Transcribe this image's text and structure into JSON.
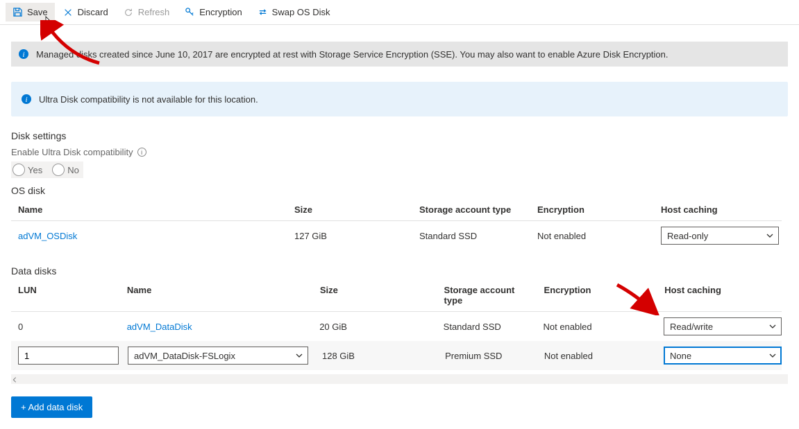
{
  "toolbar": {
    "save": "Save",
    "discard": "Discard",
    "refresh": "Refresh",
    "encryption": "Encryption",
    "swap": "Swap OS Disk"
  },
  "banners": {
    "sse": "Managed disks created since June 10, 2017 are encrypted at rest with Storage Service Encryption (SSE). You may also want to enable Azure Disk Encryption.",
    "ultra": "Ultra Disk compatibility is not available for this location."
  },
  "sections": {
    "diskSettings": "Disk settings",
    "ultraLabel": "Enable Ultra Disk compatibility",
    "yes": "Yes",
    "no": "No",
    "osDisk": "OS disk",
    "dataDisks": "Data disks"
  },
  "osTable": {
    "headers": {
      "name": "Name",
      "size": "Size",
      "storage": "Storage account type",
      "encryption": "Encryption",
      "caching": "Host caching"
    },
    "row": {
      "name": "adVM_OSDisk",
      "size": "127 GiB",
      "storage": "Standard SSD",
      "encryption": "Not enabled",
      "caching": "Read-only"
    }
  },
  "dataTable": {
    "headers": {
      "lun": "LUN",
      "name": "Name",
      "size": "Size",
      "storage": "Storage account type",
      "encryption": "Encryption",
      "caching": "Host caching"
    },
    "rows": [
      {
        "lun": "0",
        "name": "adVM_DataDisk",
        "size": "20 GiB",
        "storage": "Standard SSD",
        "encryption": "Not enabled",
        "caching": "Read/write"
      },
      {
        "lun": "1",
        "name": "adVM_DataDisk-FSLogix",
        "size": "128 GiB",
        "storage": "Premium SSD",
        "encryption": "Not enabled",
        "caching": "None"
      }
    ]
  },
  "addButton": "+ Add data disk"
}
